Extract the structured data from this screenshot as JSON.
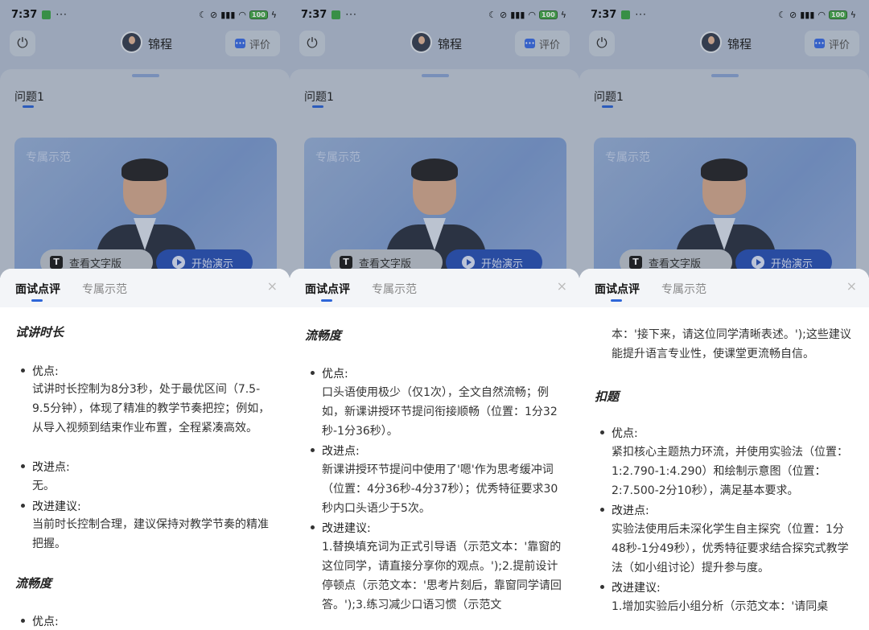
{
  "status": {
    "time": "7:37",
    "dots": "···",
    "signal": "ᯤ",
    "battery": "100"
  },
  "header": {
    "name": "锦程",
    "eval_label": "评价",
    "eval_icon": "chat-icon",
    "power_icon": "power-icon"
  },
  "page": {
    "question": "问题1",
    "video_label": "专属示范",
    "text_button": "查看文字版",
    "play_button": "开始演示"
  },
  "sheet": {
    "tab_active": "面试点评",
    "tab_inactive": "专属示范",
    "close": "×"
  },
  "panel1": {
    "sec1": "试讲时长",
    "b1": "优点:",
    "t1": "试讲时长控制为8分3秒，处于最优区间（7.5-9.5分钟），体现了精准的教学节奏把控；例如，从导入视频到结束作业布置，全程紧凑高效。",
    "b2": "改进点:",
    "t2": "无。",
    "b3": "改进建议:",
    "t3": "当前时长控制合理，建议保持对教学节奏的精准把握。",
    "sec2": "流畅度",
    "b4": "优点:"
  },
  "panel2": {
    "sec1": "流畅度",
    "b1": "优点:",
    "t1": "口头语使用极少（仅1次），全文自然流畅；例如，新课讲授环节提问衔接顺畅（位置：1分32秒-1分36秒）。",
    "b2": "改进点:",
    "t2": "新课讲授环节提问中使用了'嗯'作为思考缓冲词（位置：4分36秒-4分37秒）；优秀特征要求30秒内口头语少于5次。",
    "b3": "改进建议:",
    "t3": "1.替换填充词为正式引导语（示范文本：'靠窗的这位同学，请直接分享你的观点。');2.提前设计停顿点（示范文本：'思考片刻后，靠窗同学请回答。');3.练习减少口语习惯（示范文"
  },
  "panel3": {
    "t0": "本：'接下来，请这位同学清晰表述。');这些建议能提升语言专业性，使课堂更流畅自信。",
    "sec1": "扣题",
    "b1": "优点:",
    "t1": "紧扣核心主题热力环流，并使用实验法（位置：1:2.790-1:4.290）和绘制示意图（位置：2:7.500-2分10秒），满足基本要求。",
    "b2": "改进点:",
    "t2": "实验法使用后未深化学生自主探究（位置：1分48秒-1分49秒），优秀特征要求结合探究式教学法（如小组讨论）提升参与度。",
    "b3": "改进建议:",
    "t3": "1.增加实验后小组分析（示范文本：'请同桌"
  }
}
